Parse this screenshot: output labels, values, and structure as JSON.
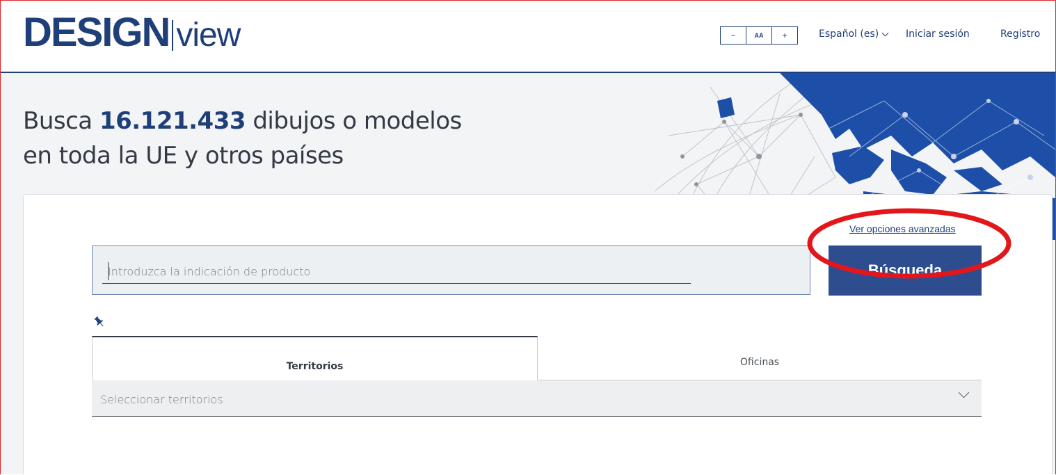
{
  "header": {
    "logo_strong": "DESIGN",
    "logo_light": "view",
    "font_controls": {
      "decrease": "−",
      "reset": "AA",
      "increase": "+"
    },
    "language": "Español (es)",
    "login": "Iniciar sesión",
    "register": "Registro"
  },
  "hero": {
    "headline_prefix": "Busca",
    "headline_count": "16.121.433",
    "headline_suffix": "dibujos o modelos",
    "headline_line2": "en toda la UE y otros países"
  },
  "search": {
    "advanced_link": "Ver opciones avanzadas",
    "placeholder": "Introduzca la indicación de producto",
    "value": "",
    "button_label": "Búsqueda"
  },
  "tabs": [
    {
      "label": "Territorios",
      "active": true
    },
    {
      "label": "Oficinas",
      "active": false
    }
  ],
  "territories_select": {
    "placeholder": "Seleccionar territorios"
  },
  "colors": {
    "brand": "#1f3f7a",
    "button": "#2e4d8f",
    "annotation": "#e3161b",
    "frame": "#e0262a"
  }
}
